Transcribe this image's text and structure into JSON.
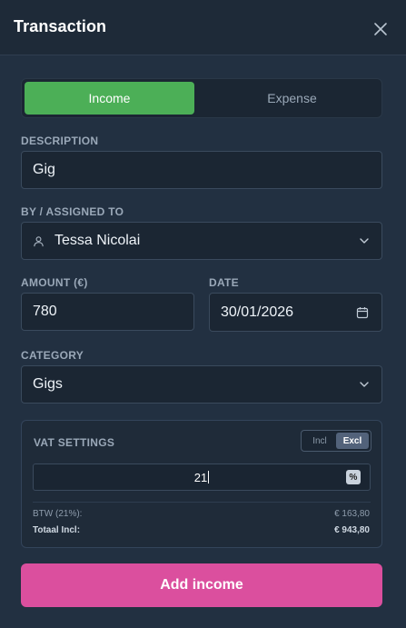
{
  "header": {
    "title": "Transaction"
  },
  "type_toggle": {
    "income_label": "Income",
    "expense_label": "Expense",
    "selected": "Income"
  },
  "description": {
    "label": "DESCRIPTION",
    "value": "Gig"
  },
  "assigned": {
    "label": "BY / ASSIGNED TO",
    "value": "Tessa Nicolai"
  },
  "amount": {
    "label": "AMOUNT (€)",
    "value": "780"
  },
  "date": {
    "label": "DATE",
    "value": "30/01/2026"
  },
  "category": {
    "label": "CATEGORY",
    "value": "Gigs"
  },
  "vat": {
    "title": "VAT SETTINGS",
    "incl_label": "Incl",
    "excl_label": "Excl",
    "selected": "Excl",
    "rate_value": "21",
    "btw_label": "BTW (21%):",
    "btw_value": "€ 163,80",
    "total_label": "Totaal Incl:",
    "total_value": "€ 943,80"
  },
  "submit": {
    "label": "Add income"
  },
  "colors": {
    "accent_income": "#4caf57",
    "submit": "#db4f9e",
    "background": "#223041"
  },
  "icons": [
    "close-icon",
    "user-icon",
    "chevron-down-icon",
    "calendar-icon",
    "percent-icon"
  ]
}
